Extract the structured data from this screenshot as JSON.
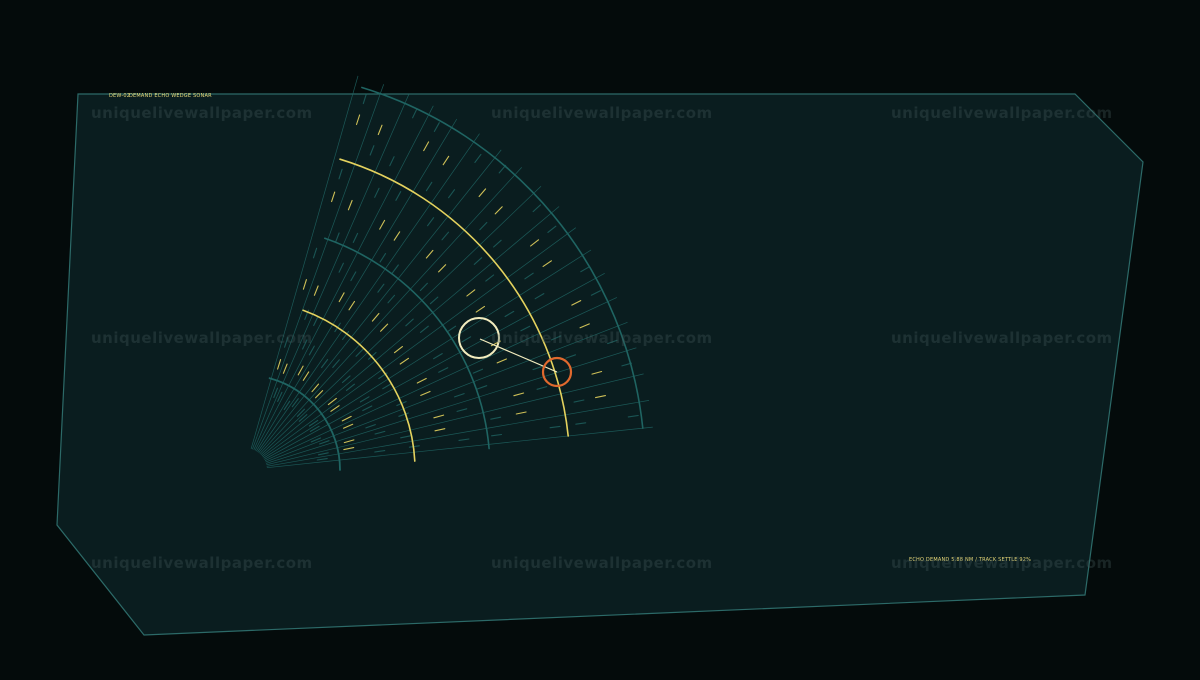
{
  "header": {
    "id": "DEW-02",
    "title": "DEMAND ECHO WEDGE SONAR"
  },
  "footer": {
    "status": "ECHO DEMAND 5.88 NM / TRACK SETTLE 92%"
  },
  "watermark": {
    "text": "uniquelivewallpaper.com"
  },
  "colors": {
    "background": "#040b0b",
    "panel_fill": "#0a1d1f",
    "panel_border": "#2c6a68",
    "grid_teal": "#1f6462",
    "accent_yellow": "#e4d25e",
    "cursor_cream": "#f2ecbe",
    "target_orange": "#e0692e",
    "label_yellow": "#e8d878"
  },
  "sonar": {
    "contact_marker": "cream-circle-contact",
    "target_marker": "orange-circle-target",
    "track_line": "contact-to-target-vector"
  }
}
